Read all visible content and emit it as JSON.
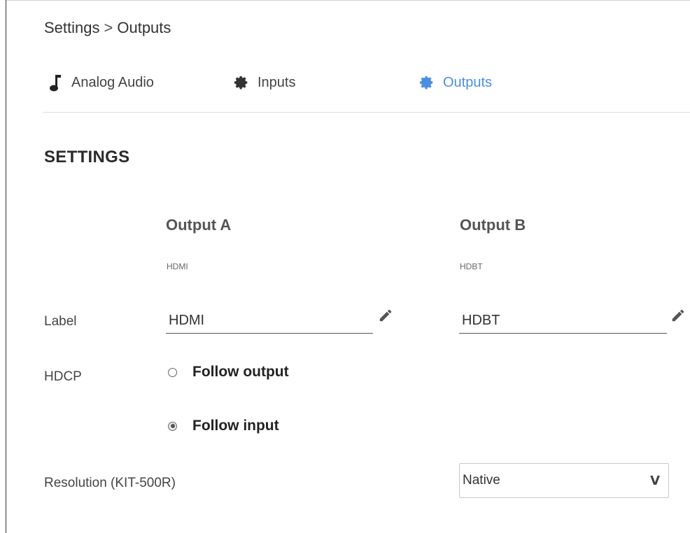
{
  "breadcrumb": {
    "parent": "Settings",
    "separator": ">",
    "current": "Outputs"
  },
  "tabs": [
    {
      "label": "Analog Audio",
      "icon": "music-note-icon",
      "active": false
    },
    {
      "label": "Inputs",
      "icon": "gear-icon",
      "active": false
    },
    {
      "label": "Outputs",
      "icon": "gear-icon",
      "active": true
    }
  ],
  "section": {
    "title": "SETTINGS"
  },
  "outputs": [
    {
      "name": "Output A",
      "type": "HDMI",
      "label_value": "HDMI"
    },
    {
      "name": "Output B",
      "type": "HDBT",
      "label_value": "HDBT"
    }
  ],
  "rows": {
    "label": "Label",
    "hdcp": "HDCP",
    "resolution": "Resolution (KIT-500R)"
  },
  "hdcp_options": [
    {
      "label": "Follow output",
      "selected": false
    },
    {
      "label": "Follow input",
      "selected": true
    }
  ],
  "resolution": {
    "selected": "Native",
    "chevron": "V"
  },
  "colors": {
    "accent": "#4a8fe0",
    "text": "#333333",
    "divider": "#dcdcdc"
  }
}
